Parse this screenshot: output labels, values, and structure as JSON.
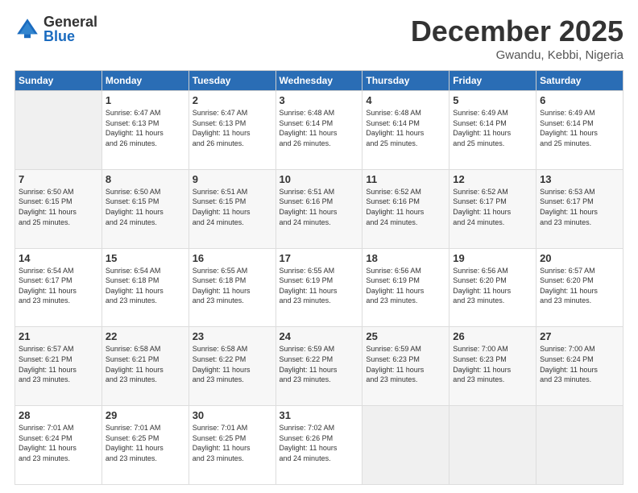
{
  "logo": {
    "general": "General",
    "blue": "Blue"
  },
  "header": {
    "month": "December 2025",
    "location": "Gwandu, Kebbi, Nigeria"
  },
  "days_of_week": [
    "Sunday",
    "Monday",
    "Tuesday",
    "Wednesday",
    "Thursday",
    "Friday",
    "Saturday"
  ],
  "weeks": [
    [
      {
        "day": "",
        "info": ""
      },
      {
        "day": "1",
        "info": "Sunrise: 6:47 AM\nSunset: 6:13 PM\nDaylight: 11 hours\nand 26 minutes."
      },
      {
        "day": "2",
        "info": "Sunrise: 6:47 AM\nSunset: 6:13 PM\nDaylight: 11 hours\nand 26 minutes."
      },
      {
        "day": "3",
        "info": "Sunrise: 6:48 AM\nSunset: 6:14 PM\nDaylight: 11 hours\nand 26 minutes."
      },
      {
        "day": "4",
        "info": "Sunrise: 6:48 AM\nSunset: 6:14 PM\nDaylight: 11 hours\nand 25 minutes."
      },
      {
        "day": "5",
        "info": "Sunrise: 6:49 AM\nSunset: 6:14 PM\nDaylight: 11 hours\nand 25 minutes."
      },
      {
        "day": "6",
        "info": "Sunrise: 6:49 AM\nSunset: 6:14 PM\nDaylight: 11 hours\nand 25 minutes."
      }
    ],
    [
      {
        "day": "7",
        "info": "Sunrise: 6:50 AM\nSunset: 6:15 PM\nDaylight: 11 hours\nand 25 minutes."
      },
      {
        "day": "8",
        "info": "Sunrise: 6:50 AM\nSunset: 6:15 PM\nDaylight: 11 hours\nand 24 minutes."
      },
      {
        "day": "9",
        "info": "Sunrise: 6:51 AM\nSunset: 6:15 PM\nDaylight: 11 hours\nand 24 minutes."
      },
      {
        "day": "10",
        "info": "Sunrise: 6:51 AM\nSunset: 6:16 PM\nDaylight: 11 hours\nand 24 minutes."
      },
      {
        "day": "11",
        "info": "Sunrise: 6:52 AM\nSunset: 6:16 PM\nDaylight: 11 hours\nand 24 minutes."
      },
      {
        "day": "12",
        "info": "Sunrise: 6:52 AM\nSunset: 6:17 PM\nDaylight: 11 hours\nand 24 minutes."
      },
      {
        "day": "13",
        "info": "Sunrise: 6:53 AM\nSunset: 6:17 PM\nDaylight: 11 hours\nand 23 minutes."
      }
    ],
    [
      {
        "day": "14",
        "info": "Sunrise: 6:54 AM\nSunset: 6:17 PM\nDaylight: 11 hours\nand 23 minutes."
      },
      {
        "day": "15",
        "info": "Sunrise: 6:54 AM\nSunset: 6:18 PM\nDaylight: 11 hours\nand 23 minutes."
      },
      {
        "day": "16",
        "info": "Sunrise: 6:55 AM\nSunset: 6:18 PM\nDaylight: 11 hours\nand 23 minutes."
      },
      {
        "day": "17",
        "info": "Sunrise: 6:55 AM\nSunset: 6:19 PM\nDaylight: 11 hours\nand 23 minutes."
      },
      {
        "day": "18",
        "info": "Sunrise: 6:56 AM\nSunset: 6:19 PM\nDaylight: 11 hours\nand 23 minutes."
      },
      {
        "day": "19",
        "info": "Sunrise: 6:56 AM\nSunset: 6:20 PM\nDaylight: 11 hours\nand 23 minutes."
      },
      {
        "day": "20",
        "info": "Sunrise: 6:57 AM\nSunset: 6:20 PM\nDaylight: 11 hours\nand 23 minutes."
      }
    ],
    [
      {
        "day": "21",
        "info": "Sunrise: 6:57 AM\nSunset: 6:21 PM\nDaylight: 11 hours\nand 23 minutes."
      },
      {
        "day": "22",
        "info": "Sunrise: 6:58 AM\nSunset: 6:21 PM\nDaylight: 11 hours\nand 23 minutes."
      },
      {
        "day": "23",
        "info": "Sunrise: 6:58 AM\nSunset: 6:22 PM\nDaylight: 11 hours\nand 23 minutes."
      },
      {
        "day": "24",
        "info": "Sunrise: 6:59 AM\nSunset: 6:22 PM\nDaylight: 11 hours\nand 23 minutes."
      },
      {
        "day": "25",
        "info": "Sunrise: 6:59 AM\nSunset: 6:23 PM\nDaylight: 11 hours\nand 23 minutes."
      },
      {
        "day": "26",
        "info": "Sunrise: 7:00 AM\nSunset: 6:23 PM\nDaylight: 11 hours\nand 23 minutes."
      },
      {
        "day": "27",
        "info": "Sunrise: 7:00 AM\nSunset: 6:24 PM\nDaylight: 11 hours\nand 23 minutes."
      }
    ],
    [
      {
        "day": "28",
        "info": "Sunrise: 7:01 AM\nSunset: 6:24 PM\nDaylight: 11 hours\nand 23 minutes."
      },
      {
        "day": "29",
        "info": "Sunrise: 7:01 AM\nSunset: 6:25 PM\nDaylight: 11 hours\nand 23 minutes."
      },
      {
        "day": "30",
        "info": "Sunrise: 7:01 AM\nSunset: 6:25 PM\nDaylight: 11 hours\nand 23 minutes."
      },
      {
        "day": "31",
        "info": "Sunrise: 7:02 AM\nSunset: 6:26 PM\nDaylight: 11 hours\nand 24 minutes."
      },
      {
        "day": "",
        "info": ""
      },
      {
        "day": "",
        "info": ""
      },
      {
        "day": "",
        "info": ""
      }
    ]
  ]
}
